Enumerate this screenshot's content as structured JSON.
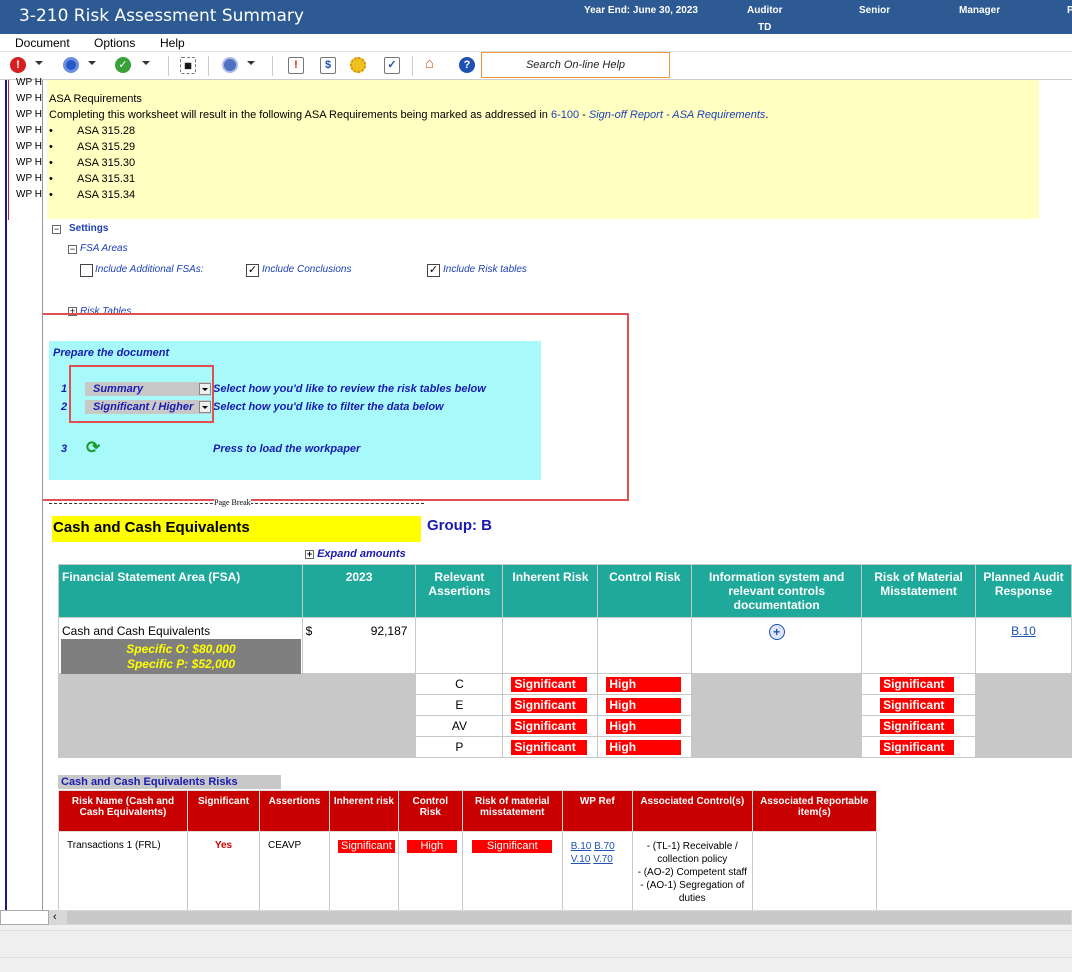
{
  "window": {
    "title": "3-210 Risk Assessment Summary",
    "year_end": "Year End: June 30, 2023",
    "auditor_label": "Auditor",
    "auditor_value": "TD",
    "senior_label": "Senior",
    "manager_label": "Manager",
    "partner_partial": "P"
  },
  "menu": {
    "document": "Document",
    "options": "Options",
    "help": "Help"
  },
  "toolbar": {
    "search_placeholder": "Search On-line Help",
    "dollar": "$"
  },
  "left_rows": [
    "WP H",
    "WP H",
    "WP H",
    "WP H",
    "WP H",
    "WP H",
    "WP H",
    "WP H"
  ],
  "asa": {
    "heading": "ASA Requirements",
    "text_before": "Completing this worksheet will result in the following ASA Requirements being marked as addressed in ",
    "link_code": "6-100",
    "dash": " - ",
    "link_text": "Sign-off Report - ASA Requirements",
    "period": ".",
    "bullet": "•",
    "items": [
      "ASA 315.28",
      "ASA 315.29",
      "ASA 315.30",
      "ASA 315.31",
      "ASA 315.34"
    ]
  },
  "settings": {
    "label": "Settings",
    "fsa_areas": "FSA Areas",
    "include_additional": "Include Additional FSAs:",
    "include_conclusions": "Include Conclusions",
    "include_risk_tables": "Include Risk tables",
    "risk_tables": "Risk Tables",
    "include_additional_checked": false,
    "include_conclusions_checked": true,
    "include_risk_tables_checked": true
  },
  "prepare": {
    "title": "Prepare the document",
    "step1": "1",
    "step2": "2",
    "step3": "3",
    "dropdown1": "Summary",
    "dropdown2": "Significant / Higher",
    "desc1": "Select how you'd like to review the risk tables below",
    "desc2": "Select how you'd like to filter the data below",
    "desc3": "Press to load the workpaper"
  },
  "page_break": "Page Break",
  "section": {
    "title": "Cash and Cash Equivalents",
    "group": "Group: B",
    "expand": "Expand amounts"
  },
  "fsa_table": {
    "headers": [
      "Financial Statement Area (FSA)",
      "2023",
      "Relevant Assertions",
      "Inherent Risk",
      "Control Risk",
      "Information system and relevant controls documentation",
      "Risk of Material Misstatement",
      "Planned Audit Response"
    ],
    "row_name": "Cash and Cash Equivalents",
    "specific_o": "Specific O:  $80,000",
    "specific_p": "Specific P:  $52,000",
    "currency": "$",
    "amount": "92,187",
    "planned_response": "B.10",
    "assertions": [
      {
        "code": "C",
        "inherent": "Significant",
        "control": "High",
        "romm": "Significant"
      },
      {
        "code": "E",
        "inherent": "Significant",
        "control": "High",
        "romm": "Significant"
      },
      {
        "code": "AV",
        "inherent": "Significant",
        "control": "High",
        "romm": "Significant"
      },
      {
        "code": "P",
        "inherent": "Significant",
        "control": "High",
        "romm": "Significant"
      }
    ]
  },
  "risks": {
    "title": "Cash and Cash Equivalents Risks",
    "headers": {
      "risk_name": "Risk Name (Cash and Cash Equivalents)",
      "significant": "Significant",
      "assertions": "Assertions",
      "inherent": "Inherent risk",
      "control": "Control Risk",
      "romm": "Risk of material misstatement",
      "wpref": "WP Ref",
      "controls": "Associated Control(s)",
      "reportable": "Associated Reportable item(s)"
    },
    "row": {
      "name": "Transactions 1 (FRL)",
      "significant": "Yes",
      "assertions": "CEAVP",
      "inherent": "Significant",
      "control": "High",
      "romm": "Significant",
      "wp_refs": [
        "B.10",
        "B.70",
        "V.10",
        "V.70"
      ],
      "controls": [
        "- (TL-1) Receivable / collection policy",
        "- (AO-2) Competent staff",
        "- (AO-1) Segregation of duties"
      ]
    }
  },
  "colors": {
    "titlebar": "#2d5a92",
    "teal_header": "#1fa99a",
    "red_header": "#c80000",
    "tag_red": "#ff0000",
    "cyan_panel": "#a8fafa",
    "yellow_panel": "#ffffc2"
  }
}
